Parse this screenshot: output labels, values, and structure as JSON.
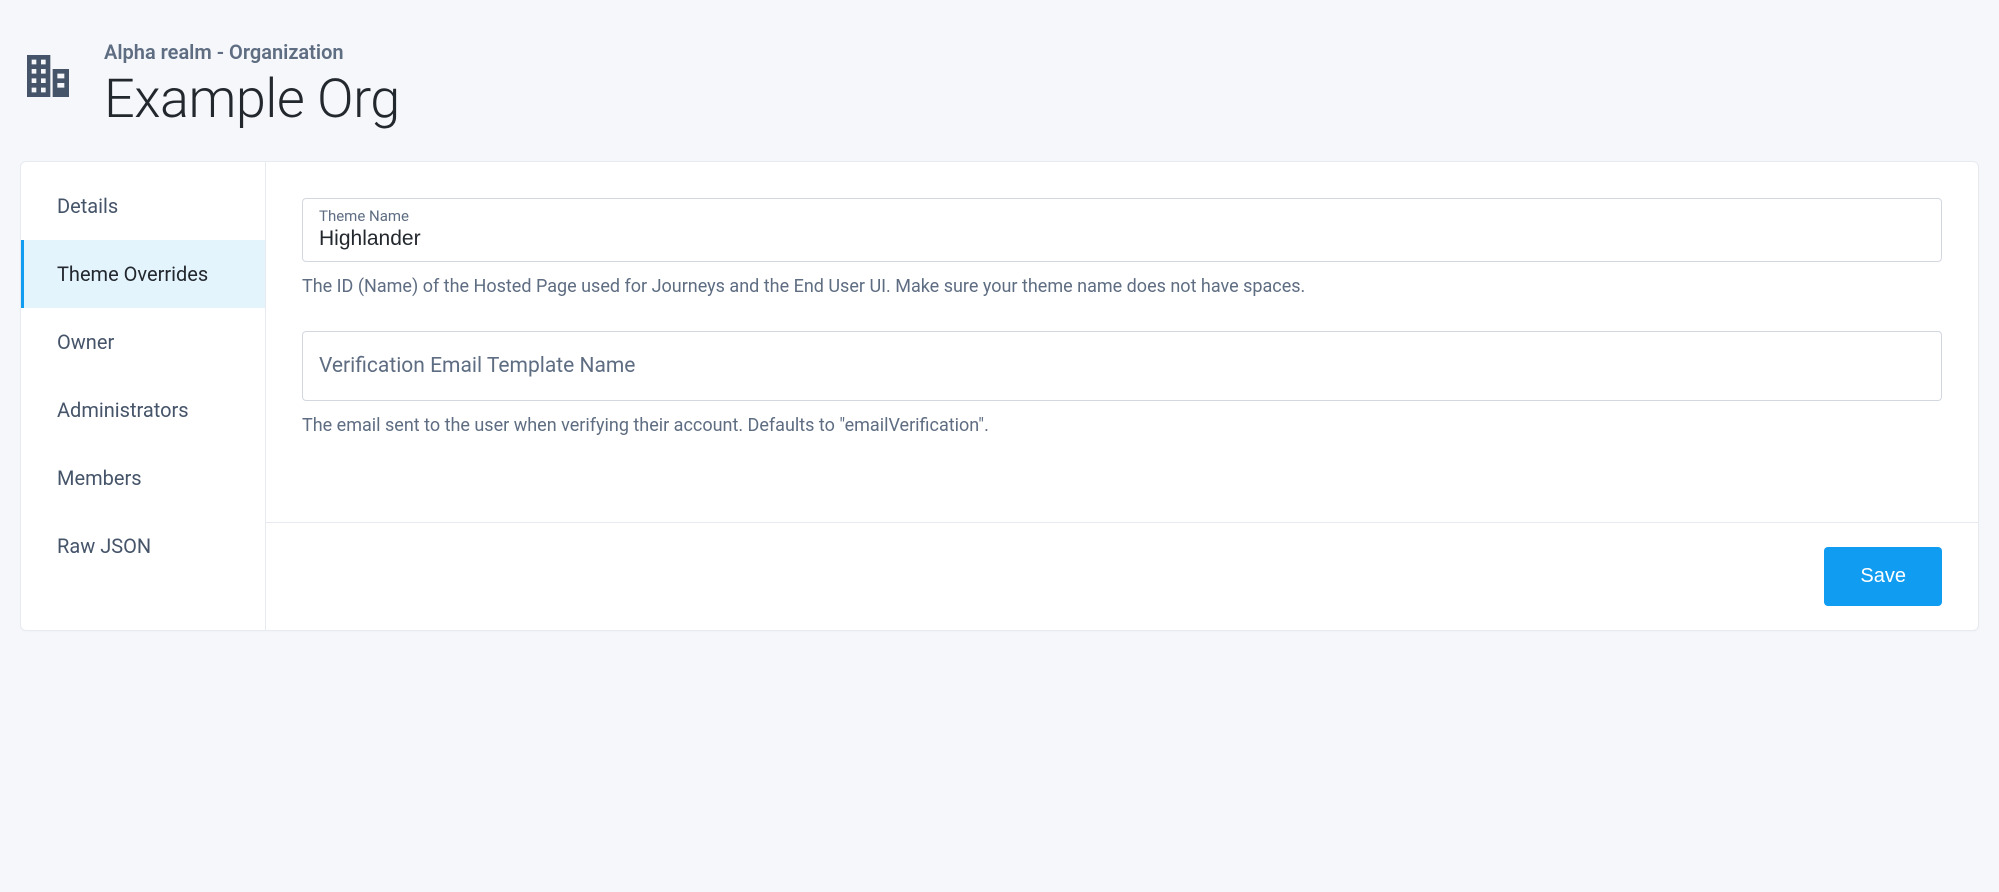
{
  "header": {
    "breadcrumb": "Alpha realm - Organization",
    "title": "Example Org"
  },
  "sidebar": {
    "items": [
      {
        "label": "Details",
        "active": false
      },
      {
        "label": "Theme Overrides",
        "active": true
      },
      {
        "label": "Owner",
        "active": false
      },
      {
        "label": "Administrators",
        "active": false
      },
      {
        "label": "Members",
        "active": false
      },
      {
        "label": "Raw JSON",
        "active": false
      }
    ]
  },
  "form": {
    "theme_name": {
      "label": "Theme Name",
      "value": "Highlander",
      "help": "The ID (Name) of the Hosted Page used for Journeys and the End User UI. Make sure your theme name does not have spaces."
    },
    "verification_email": {
      "placeholder": "Verification Email Template Name",
      "value": "",
      "help": "The email sent to the user when verifying their account. Defaults to \"emailVerification\"."
    }
  },
  "actions": {
    "save_label": "Save"
  },
  "icons": {
    "organization": "organization-icon"
  },
  "colors": {
    "accent": "#109cf1",
    "active_bg": "#e4f4fd",
    "text_muted": "#5e6d82",
    "border": "#d3d8e0"
  }
}
